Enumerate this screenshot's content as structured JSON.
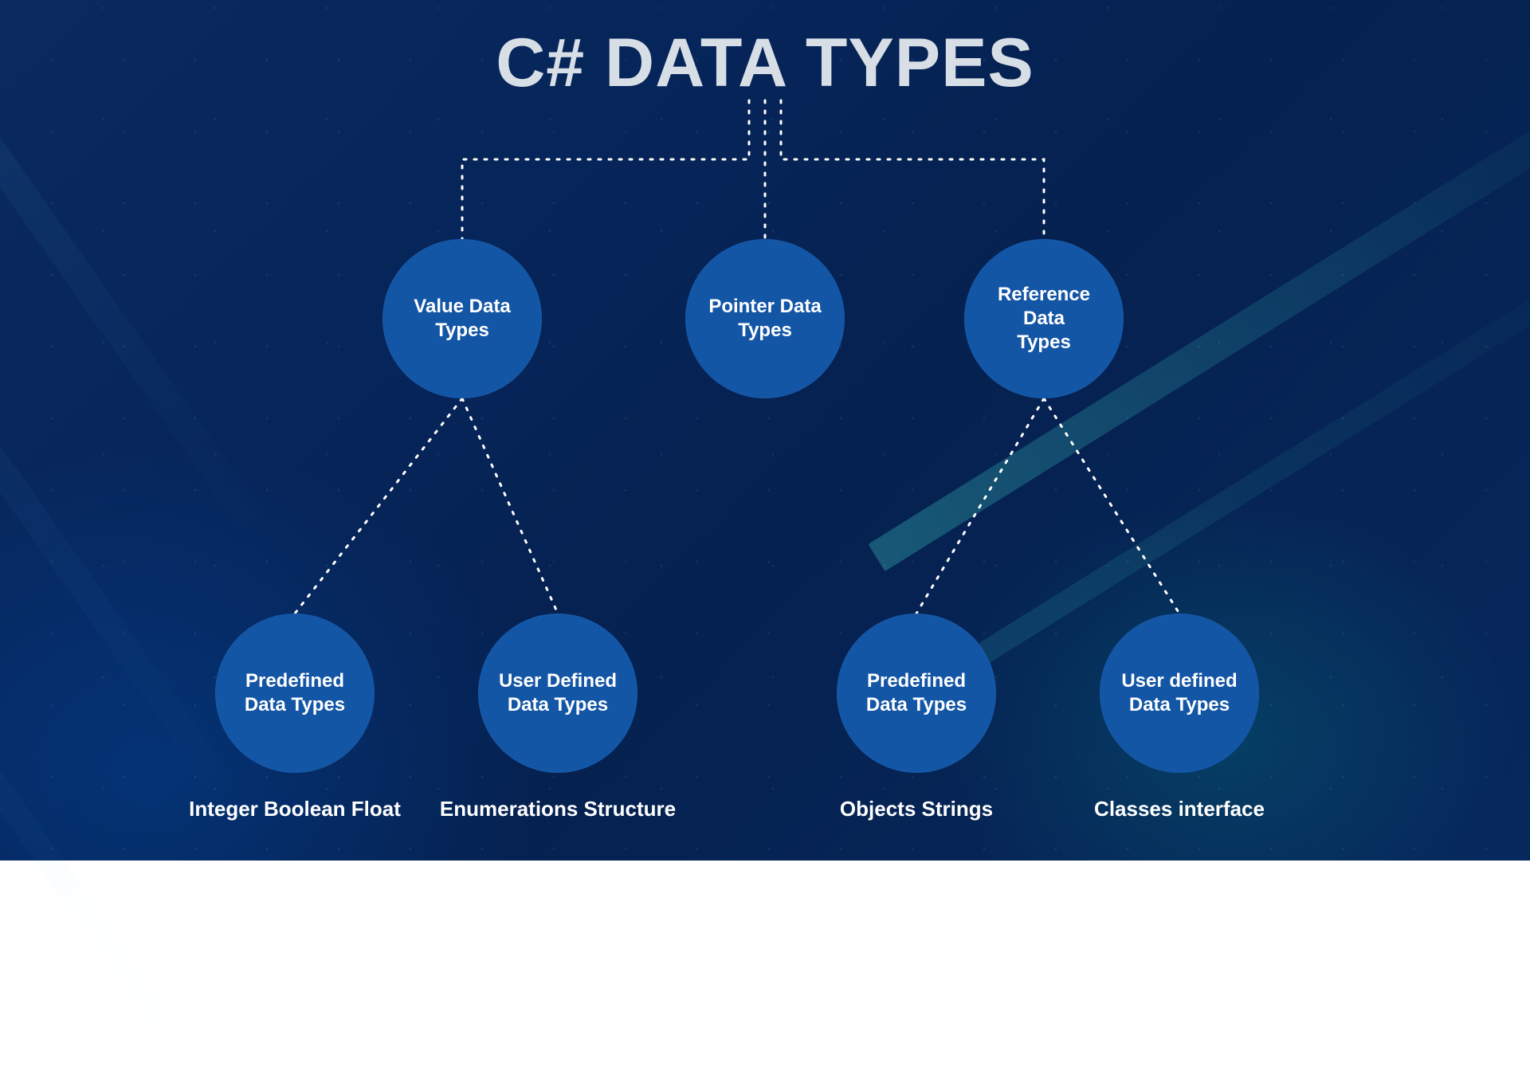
{
  "title": "C# DATA TYPES",
  "nodes": {
    "value": {
      "label": "Value Data\nTypes"
    },
    "pointer": {
      "label": "Pointer Data\nTypes"
    },
    "reference": {
      "label": "Reference Data\nTypes"
    },
    "val_predef": {
      "label": "Predefined\nData Types",
      "examples": "Integer Boolean Float"
    },
    "val_userdef": {
      "label": "User Defined\nData Types",
      "examples": "Enumerations Structure"
    },
    "ref_predef": {
      "label": "Predefined\nData Types",
      "examples": "Objects Strings"
    },
    "ref_userdef": {
      "label": "User defined\nData Types",
      "examples": "Classes interface"
    }
  }
}
